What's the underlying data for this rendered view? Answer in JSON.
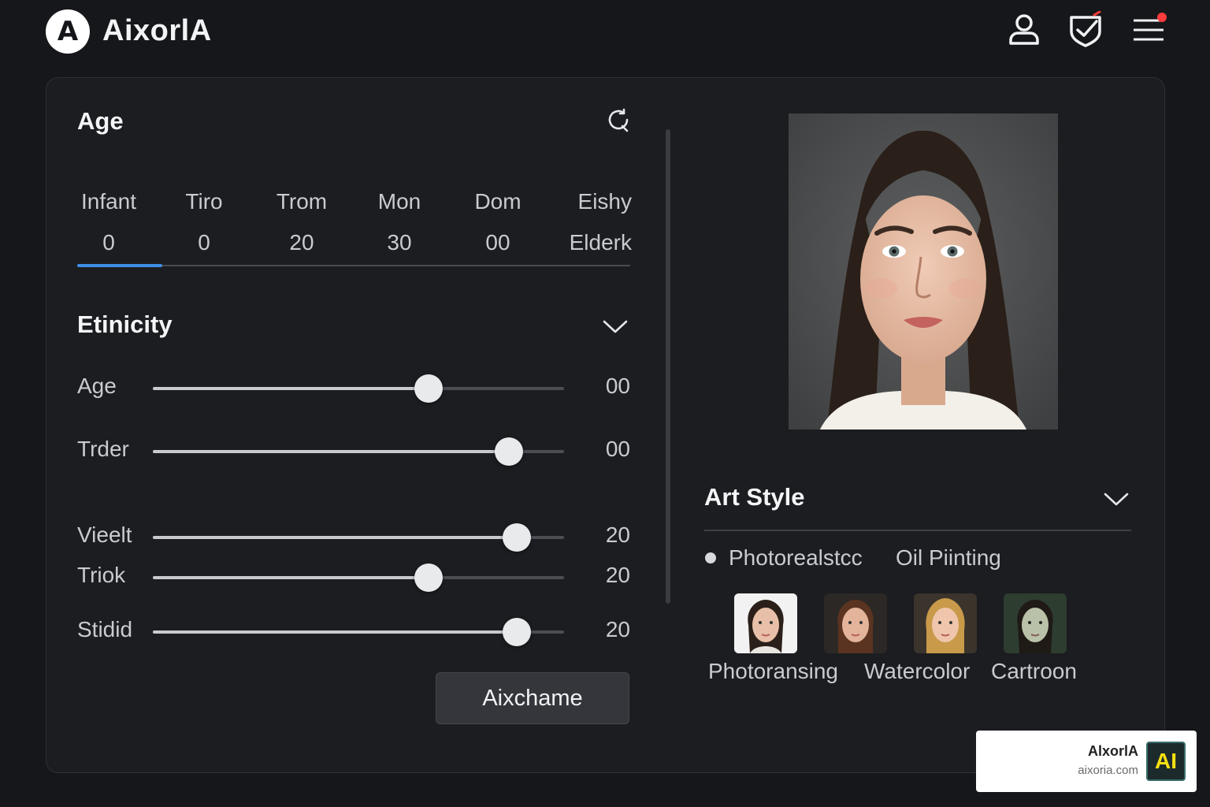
{
  "brand": {
    "logo_glyph": "A",
    "name": "AixorlA"
  },
  "header_icons": [
    "user-icon",
    "shield-check-icon",
    "menu-icon"
  ],
  "age_section": {
    "title": "Age",
    "tabs": [
      {
        "label": "Infant",
        "value": "0"
      },
      {
        "label": "Tiro",
        "value": "0"
      },
      {
        "label": "Trom",
        "value": "20"
      },
      {
        "label": "Mon",
        "value": "30"
      },
      {
        "label": "Dom",
        "value": "00"
      },
      {
        "label": "Eishy",
        "value": "Elderk"
      }
    ],
    "active_tab_index": 0
  },
  "ethnicity_section": {
    "title": "Etinicity",
    "sliders": [
      {
        "label": "Age",
        "value": "00",
        "level": 0.67
      },
      {
        "label": "Trder",
        "value": "00",
        "level": 0.865
      },
      {
        "label": "Vieelt",
        "value": "20",
        "level": 0.885
      },
      {
        "label": "Triok",
        "value": "20",
        "level": 0.67
      },
      {
        "label": "Stidid",
        "value": "20",
        "level": 0.885
      }
    ],
    "action_button": "Aixchame"
  },
  "art_style": {
    "title": "Art Style",
    "options": [
      {
        "label": "Photorealstcc",
        "selected": true
      },
      {
        "label": "Oil Piinting",
        "selected": false
      }
    ],
    "styles": [
      {
        "label": "Photoransing",
        "hair": "#2b1f1a",
        "bg": "#f2f2f2"
      },
      {
        "label": "Watercolor",
        "hair": "#5a3420",
        "bg": "#2c2826"
      },
      {
        "label": "Cartroon",
        "hair": "#c89a4a",
        "bg": "#3a342c"
      },
      {
        "label": "",
        "hair": "#1f1a16",
        "bg": "#2d3d30"
      }
    ]
  },
  "watermark": {
    "name": "AlxorlA",
    "url": "aixoria.com",
    "badge": "AI"
  },
  "colors": {
    "accent": "#3d8ee8",
    "notification": "#ff3b3b",
    "background": "#16171a",
    "panel": "#1c1d20"
  }
}
